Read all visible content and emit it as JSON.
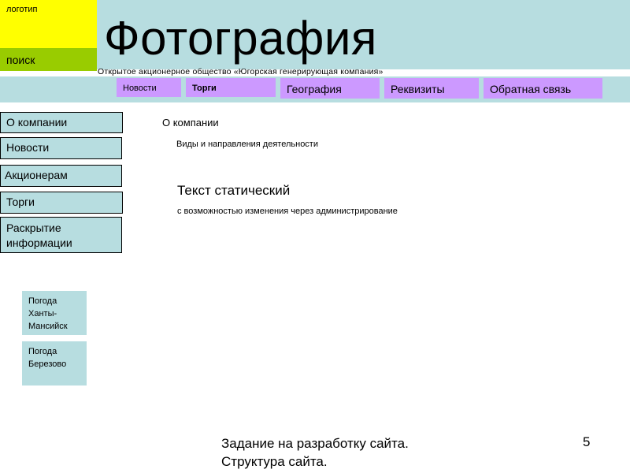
{
  "header": {
    "logo_label": "логотип",
    "search_label": "поиск",
    "title": "Фотография",
    "company": "Открытое акционерное общество «Югорская генерирующая компания»"
  },
  "top_nav": [
    {
      "label": "Новости"
    },
    {
      "label": "Торги"
    },
    {
      "label": "География"
    },
    {
      "label": "Реквизиты"
    },
    {
      "label": "Обратная связь"
    }
  ],
  "sidebar": {
    "items": [
      {
        "label": "О компании"
      },
      {
        "label": "Новости"
      },
      {
        "label": "Акционерам"
      },
      {
        "label": "Торги"
      },
      {
        "label": "Раскрытие информации"
      }
    ]
  },
  "weather": [
    {
      "label": "Погода Ханты-Мансийск"
    },
    {
      "label": "Погода Березово"
    }
  ],
  "content": {
    "heading": "О компании",
    "subheading": "Виды и направления деятельности",
    "static_text": "Текст статический",
    "static_note": "с возможностью изменения через администрирование"
  },
  "footer": {
    "caption": "Задание на разработку сайта. Структура сайта.",
    "page_number": "5"
  },
  "colors": {
    "logo_bg": "#ffff00",
    "search_bg": "#99cc00",
    "band_bg": "#b7dde0",
    "tab_bg": "#cc99ff"
  }
}
